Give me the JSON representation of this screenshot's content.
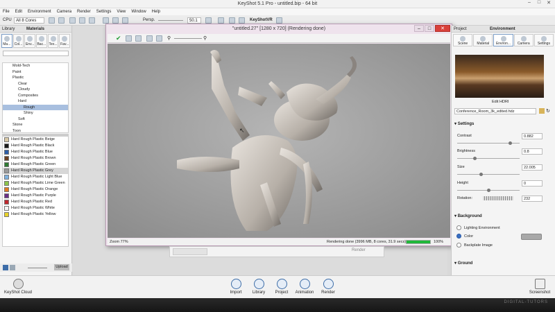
{
  "window": {
    "title": "KeyShot 5.1 Pro - untitled.bip - 64 bit"
  },
  "menu": [
    "File",
    "Edit",
    "Environment",
    "Camera",
    "Render",
    "Settings",
    "View",
    "Window",
    "Help"
  ],
  "toolbar": {
    "cpu_label": "CPU",
    "cores_value": "All 8 Cores",
    "persp_label": "Persp.",
    "fov_value": "50.1",
    "keyshotvr_label": "KeyShotVR"
  },
  "library": {
    "header_left": "Library",
    "header_title": "Materials",
    "tabs": [
      "Ma...",
      "Col...",
      "Env...",
      "Bac...",
      "Tex...",
      "Fav..."
    ],
    "tree": [
      {
        "label": "Mold-Tech",
        "indent": 1
      },
      {
        "label": "Paint",
        "indent": 1
      },
      {
        "label": "Plastic",
        "indent": 1
      },
      {
        "label": "Clear",
        "indent": 2
      },
      {
        "label": "Cloudy",
        "indent": 2
      },
      {
        "label": "Composites",
        "indent": 2
      },
      {
        "label": "Hard",
        "indent": 2
      },
      {
        "label": "Rough",
        "indent": 3,
        "selected": true
      },
      {
        "label": "Shiny",
        "indent": 3
      },
      {
        "label": "Soft",
        "indent": 2
      },
      {
        "label": "Stone",
        "indent": 1
      },
      {
        "label": "Toon",
        "indent": 1
      }
    ],
    "materials": [
      {
        "name": "Hard Rough Plastic Beige",
        "color": "#d9c9a6"
      },
      {
        "name": "Hard Rough Plastic Black",
        "color": "#1a1a1a"
      },
      {
        "name": "Hard Rough Plastic Blue",
        "color": "#2e5ea8"
      },
      {
        "name": "Hard Rough Plastic Brown",
        "color": "#6b3f22"
      },
      {
        "name": "Hard Rough Plastic Green",
        "color": "#2f7a33"
      },
      {
        "name": "Hard Rough Plastic Grey",
        "color": "#9a9a9a",
        "selected": true
      },
      {
        "name": "Hard Rough Plastic Light Blue",
        "color": "#7fb2e0"
      },
      {
        "name": "Hard Rough Plastic Lime Green",
        "color": "#8bc34a"
      },
      {
        "name": "Hard Rough Plastic Orange",
        "color": "#e07a22"
      },
      {
        "name": "Hard Rough Plastic Purple",
        "color": "#6a2f86"
      },
      {
        "name": "Hard Rough Plastic Red",
        "color": "#c0272d"
      },
      {
        "name": "Hard Rough Plastic White",
        "color": "#f4f4f4"
      },
      {
        "name": "Hard Rough Plastic Yellow",
        "color": "#e8d22a"
      }
    ],
    "upload_label": "Upload"
  },
  "render_window": {
    "title": "\"untitled.27\" [1280 x 720] (Rendering done)",
    "zoom": "Zoom 77%",
    "status": "Rendering done (3996 MB, 8 cores, 31.9 secs)",
    "progress_value": 1.0,
    "progress_label": "100%"
  },
  "under_panel": {
    "render_label": "Render"
  },
  "project": {
    "header_left": "Project",
    "header_title": "Environment",
    "tabs": [
      "Scene",
      "Material",
      "Environ...",
      "Camera",
      "Settings"
    ],
    "edit_hdri": "Edit HDRI",
    "hdri_file": "Conference_Room_3k_edited.hdz",
    "settings_title": "Settings",
    "settings": [
      {
        "label": "Contrast",
        "value": "0.882",
        "slider": 0.86
      },
      {
        "label": "Brightness",
        "value": "0.8",
        "slider": 0.27
      },
      {
        "label": "Size",
        "value": "22.005",
        "slider": 0.37
      },
      {
        "label": "Height",
        "value": "0",
        "slider": 0.5
      }
    ],
    "rotation_label": "Rotation:",
    "rotation_value": "232",
    "background_title": "Background",
    "background_options": [
      {
        "label": "Lighting Environment",
        "selected": false
      },
      {
        "label": "Color",
        "selected": true
      },
      {
        "label": "Backplate Image",
        "selected": false
      }
    ],
    "bg_color": "#a8a8a8",
    "ground_title": "Ground"
  },
  "bottom": {
    "cloud_label": "KeyShot Cloud",
    "buttons": [
      "Import",
      "Library",
      "Project",
      "Animation",
      "Render"
    ],
    "screenshot_label": "Screenshot"
  },
  "watermark": "DIGITAL-TUTORS"
}
